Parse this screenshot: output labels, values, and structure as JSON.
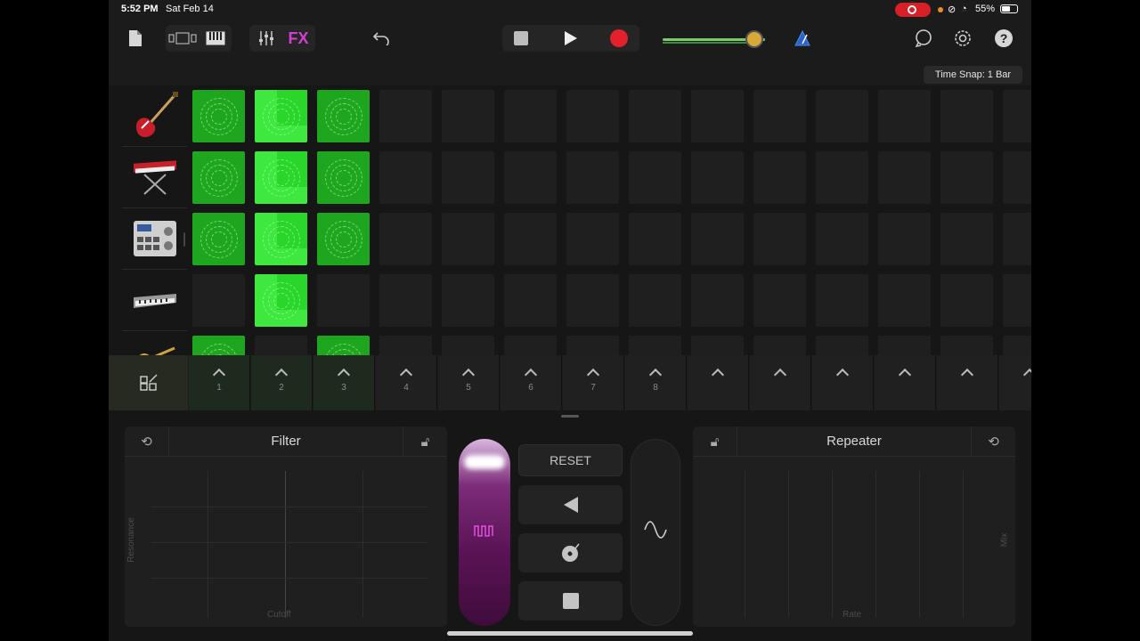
{
  "status_bar": {
    "time": "5:52 PM",
    "date": "Sat Feb 14",
    "battery": "55%"
  },
  "toolbar": {
    "fx_label": "FX",
    "volume_level": 0.9,
    "icons": [
      "document-icon",
      "view-toggle-icon",
      "keyboard-icon",
      "mixer-icon",
      "fx",
      "undo-icon",
      "stop-icon",
      "play-icon",
      "record-icon",
      "volume-slider",
      "metronome-icon",
      "loop-icon",
      "settings-icon",
      "help-icon"
    ]
  },
  "time_snap": "Time Snap: 1 Bar",
  "instruments": [
    "bass-guitar",
    "synth-keyboard",
    "drum-machine",
    "keyboard-controller",
    "brass"
  ],
  "grid": {
    "rows": [
      [
        "on",
        "play",
        "on",
        "off",
        "off",
        "off",
        "off",
        "off",
        "off",
        "off",
        "off",
        "off",
        "off",
        "off"
      ],
      [
        "on",
        "play",
        "on",
        "off",
        "off",
        "off",
        "off",
        "off",
        "off",
        "off",
        "off",
        "off",
        "off",
        "off"
      ],
      [
        "on",
        "play",
        "on",
        "off",
        "off",
        "off",
        "off",
        "off",
        "off",
        "off",
        "off",
        "off",
        "off",
        "off"
      ],
      [
        "off",
        "play",
        "off",
        "off",
        "off",
        "off",
        "off",
        "off",
        "off",
        "off",
        "off",
        "off",
        "off",
        "off"
      ],
      [
        "on",
        "off",
        "on",
        "off",
        "off",
        "off",
        "off",
        "off",
        "off",
        "off",
        "off",
        "off",
        "off",
        "off"
      ]
    ]
  },
  "triggers": [
    "1",
    "2",
    "3",
    "4",
    "5",
    "6",
    "7",
    "8",
    "",
    "",
    "",
    "",
    "",
    ""
  ],
  "fx": {
    "left_pad": {
      "title": "Filter",
      "x_label": "Cutoff",
      "y_label": "Resonance"
    },
    "right_pad": {
      "title": "Repeater",
      "x_label": "Rate",
      "y_label": "Mix"
    },
    "reset_label": "RESET",
    "gate_icon": "square-wave-icon",
    "wave_icon": "sine-wave-icon"
  },
  "colors": {
    "accent_green": "#3ee83e",
    "fx_magenta": "#d43fd0",
    "record_red": "#e3202b"
  }
}
